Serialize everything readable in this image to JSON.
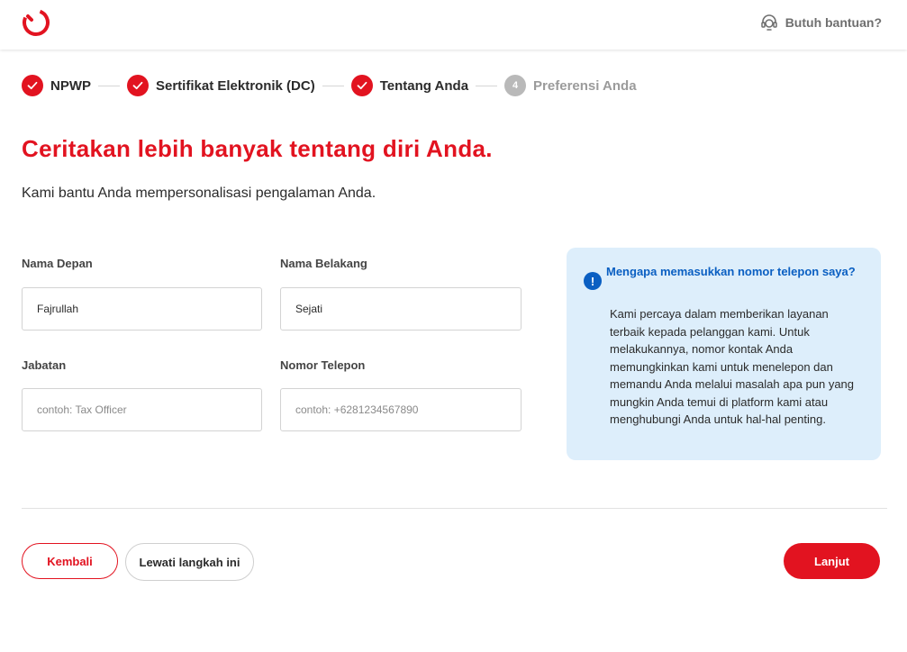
{
  "header": {
    "help_label": "Butuh bantuan?"
  },
  "stepper": {
    "steps": [
      {
        "label": "NPWP",
        "state": "done"
      },
      {
        "label": "Sertifikat Elektronik (DC)",
        "state": "done"
      },
      {
        "label": "Tentang Anda",
        "state": "done"
      },
      {
        "label": "Preferensi Anda",
        "state": "todo",
        "number": "4"
      }
    ]
  },
  "page": {
    "title": "Ceritakan lebih banyak tentang diri Anda.",
    "subtitle": "Kami bantu Anda mempersonalisasi pengalaman Anda."
  },
  "form": {
    "first_name": {
      "label": "Nama Depan",
      "value": "Fajrullah"
    },
    "last_name": {
      "label": "Nama Belakang",
      "value": "Sejati"
    },
    "position": {
      "label": "Jabatan",
      "value": "",
      "placeholder": "contoh: Tax Officer"
    },
    "phone": {
      "label": "Nomor Telepon",
      "value": "",
      "placeholder": "contoh: +6281234567890"
    }
  },
  "info": {
    "icon": "!",
    "title": "Mengapa memasukkan nomor telepon saya?",
    "body": "Kami percaya dalam memberikan layanan terbaik kepada pelanggan kami. Untuk melakukannya, nomor kontak Anda memungkinkan kami untuk menelepon dan memandu Anda melalui masalah apa pun yang mungkin Anda temui di platform kami atau menghubungi Anda untuk hal-hal penting."
  },
  "actions": {
    "back_label": "Kembali",
    "skip_label": "Lewati langkah ini",
    "next_label": "Lanjut"
  },
  "colors": {
    "brand": "#e21320",
    "info_bg": "#ddeefb",
    "info_accent": "#0a5fc2"
  }
}
